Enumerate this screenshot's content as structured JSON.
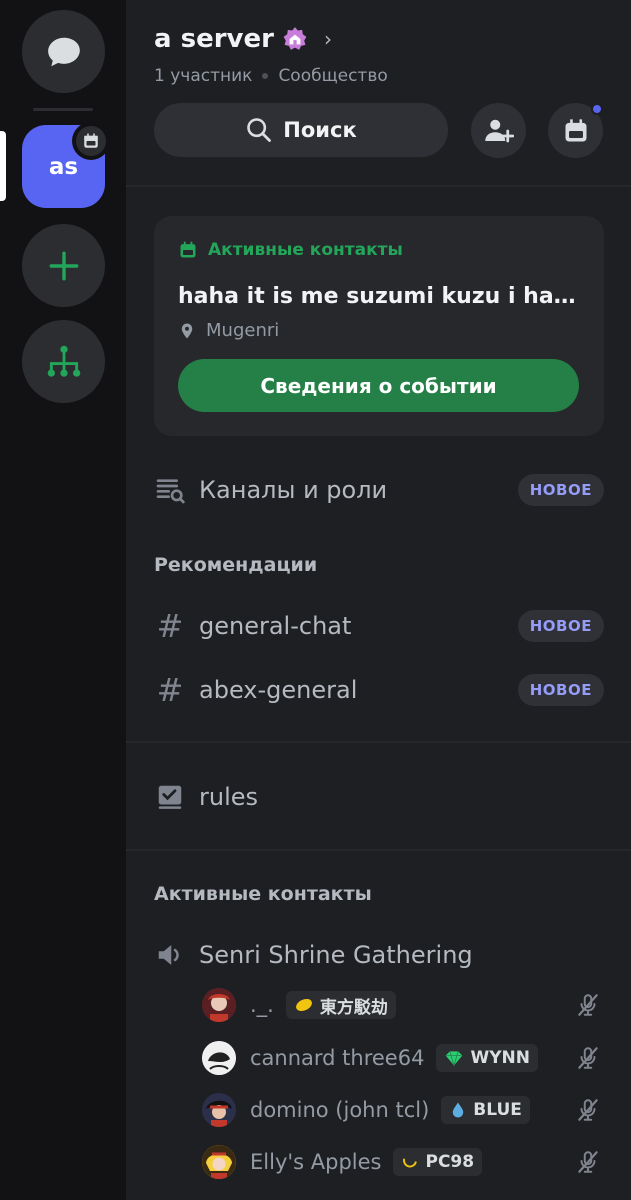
{
  "server": {
    "name": "a server",
    "members": "1 участник",
    "type": "Сообщество",
    "avatar_initials": "as"
  },
  "toolbar": {
    "search_label": "Поиск"
  },
  "event": {
    "tag": "Активные контакты",
    "title": "haha it is me suzumi kuzu i have...",
    "location": "Mugenri",
    "button": "Сведения о событии"
  },
  "channels_roles": {
    "label": "Каналы и роли",
    "badge": "НОВОЕ"
  },
  "recommendations": {
    "title": "Рекомендации",
    "items": [
      {
        "name": "general-chat",
        "badge": "НОВОЕ"
      },
      {
        "name": "abex-general",
        "badge": "НОВОЕ"
      }
    ]
  },
  "rules": {
    "name": "rules"
  },
  "active": {
    "title": "Активные контакты",
    "voice_channel": "Senri Shrine Gathering",
    "users": [
      {
        "name": "._.",
        "tag": "東方駁劫"
      },
      {
        "name": "cannard three64",
        "tag": "WYNN"
      },
      {
        "name": "domino (john tcl)",
        "tag": "BLUE"
      },
      {
        "name": "Elly's Apples",
        "tag": "PC98"
      }
    ]
  },
  "colors": {
    "accent": "#5865f2",
    "green": "#23a55a",
    "button_green": "#248046",
    "new_badge_text": "#949cf7"
  }
}
